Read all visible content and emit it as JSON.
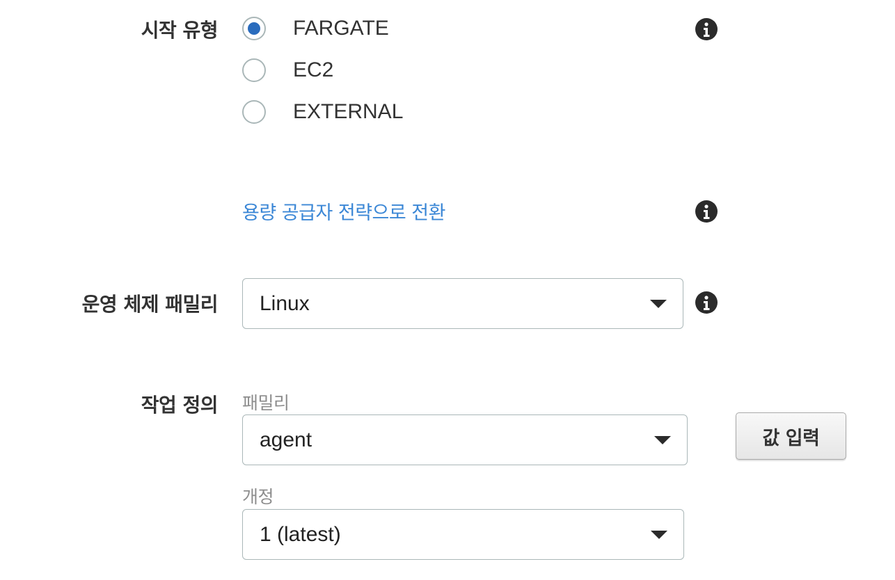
{
  "launch_type": {
    "label": "시작 유형",
    "options": [
      {
        "label": "FARGATE",
        "selected": true
      },
      {
        "label": "EC2",
        "selected": false
      },
      {
        "label": "EXTERNAL",
        "selected": false
      }
    ]
  },
  "capacity_link": {
    "label": "용량 공급자 전략으로 전환"
  },
  "os_family": {
    "label": "운영 체제 패밀리",
    "value": "Linux"
  },
  "task_definition": {
    "label": "작업 정의",
    "family_label": "패밀리",
    "family_value": "agent",
    "revision_label": "개정",
    "revision_value": "1 (latest)",
    "enter_value_button": "값 입력"
  },
  "icons": {
    "info": "info-icon",
    "dropdown": "caret-down-icon"
  },
  "colors": {
    "accent_blue": "#2a6cbd",
    "link_blue": "#3b87d6",
    "text": "#333333",
    "muted": "#8d8d8d"
  }
}
